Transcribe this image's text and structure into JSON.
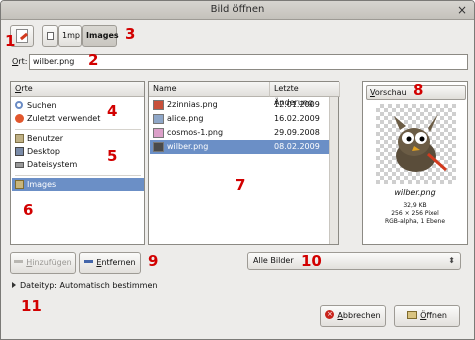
{
  "window": {
    "title": "Bild öffnen",
    "close_glyph": "×"
  },
  "toolbar": {
    "edit_toggle_icon": "edit-location-icon",
    "crumbs": [
      "1mp",
      "Images"
    ]
  },
  "name_field": {
    "label_prefix": "O",
    "label_rest": "rt:",
    "value": "wilber.png"
  },
  "places": {
    "header_u": "O",
    "header_rest": "rte",
    "items": [
      {
        "label": "Suchen",
        "icon": "search-icon",
        "color": "#6a8bc4"
      },
      {
        "label": "Zuletzt verwendet",
        "icon": "clock-icon",
        "color": "#e2572d"
      },
      {
        "label": "Benutzer",
        "icon": "home-folder-icon",
        "color": "#bfb084"
      },
      {
        "label": "Desktop",
        "icon": "desktop-icon",
        "color": "#7a8ba8"
      },
      {
        "label": "Dateisystem",
        "icon": "drive-icon",
        "color": "#777777"
      },
      {
        "label": "Images",
        "icon": "folder-icon",
        "color": "#c8b57b",
        "selected": true
      }
    ]
  },
  "files": {
    "col_name": "Name",
    "col_date": "Letzte Änderung",
    "rows": [
      {
        "name": "2zinnias.png",
        "date": "12.01.2009",
        "thumb": "#c8503a"
      },
      {
        "name": "alice.png",
        "date": "16.02.2009",
        "thumb": "#8fa7c8"
      },
      {
        "name": "cosmos-1.png",
        "date": "29.09.2008",
        "thumb": "#dca0c9"
      },
      {
        "name": "wilber.png",
        "date": "08.02.2009",
        "thumb": "#4a4a4a",
        "selected": true
      }
    ]
  },
  "preview": {
    "label_u": "V",
    "label_rest": "orschau",
    "filename": "wilber.png",
    "info": [
      "32,9 KB",
      "256 × 256 Pixel",
      "RGB-alpha, 1 Ebene"
    ]
  },
  "buttons": {
    "add_u": "H",
    "add_rest": "inzufügen",
    "remove_u": "E",
    "remove_rest": "ntfernen",
    "cancel_u": "A",
    "cancel_rest": "bbrechen",
    "open_u": "Ö",
    "open_rest": "ffnen"
  },
  "filter": {
    "value": "Alle Bilder"
  },
  "expander": {
    "label": "Dateityp: Automatisch bestimmen"
  },
  "annotations": [
    "1",
    "2",
    "3",
    "4",
    "5",
    "6",
    "7",
    "8",
    "9",
    "10",
    "11"
  ],
  "colors": {
    "selection": "#6b8fc6",
    "annotation": "#d20000"
  }
}
